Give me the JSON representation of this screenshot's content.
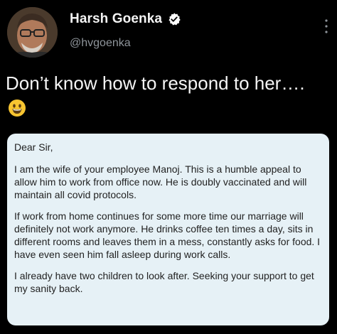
{
  "tweet": {
    "author_name": "Harsh Goenka",
    "author_handle": "@hvgoenka",
    "verified": true,
    "text": "Don’t know how to respond to her….",
    "emoji": "grinning-face-emoji"
  },
  "letter": {
    "greeting": "Dear Sir,",
    "paragraphs": [
      "I am the wife of your employee Manoj. This is a humble appeal to allow him to work from office now. He is doubly vaccinated and will maintain all covid protocols.",
      "If work from home continues for some more time our marriage will definitely not work anymore. He drinks coffee ten times a day, sits in different rooms and leaves them in a mess, constantly asks for food. I have even seen him fall asleep during work calls.",
      "I already have two children to look after. Seeking your support to get my sanity back."
    ]
  },
  "colors": {
    "background": "#000000",
    "handle": "#8f959b",
    "card": "#e6f1f6",
    "badge": "#ffffff"
  }
}
